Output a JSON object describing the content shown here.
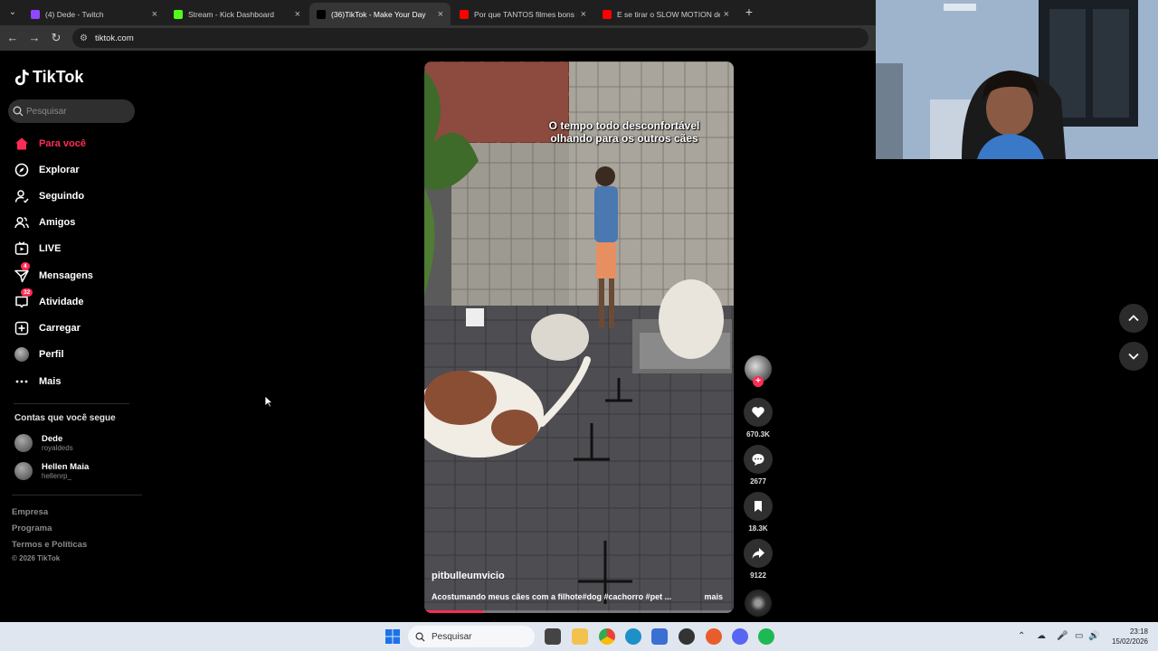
{
  "browser": {
    "tabs": [
      {
        "title": "(4) Dede - Twitch",
        "favicon": "twitch-icon",
        "color": "#9146ff",
        "active": false
      },
      {
        "title": "Stream - Kick Dashboard",
        "favicon": "kick-icon",
        "color": "#53fc18",
        "active": false
      },
      {
        "title": "(36)TikTok - Make Your Day",
        "favicon": "tiktok-icon",
        "color": "#ffffff",
        "active": true
      },
      {
        "title": "Por que TANTOS filmes bons n...",
        "favicon": "youtube-icon",
        "color": "#ff0000",
        "active": false
      },
      {
        "title": "E se tirar o SLOW MOTION de ...",
        "favicon": "youtube-icon",
        "color": "#ff0000",
        "active": false
      }
    ],
    "new_tab": "+",
    "url": "tiktok.com"
  },
  "tiktok": {
    "logo_text": "TikTok",
    "search_placeholder": "Pesquisar",
    "nav": [
      {
        "label": "Para você",
        "icon": "home-icon",
        "active": true
      },
      {
        "label": "Explorar",
        "icon": "compass-icon"
      },
      {
        "label": "Seguindo",
        "icon": "following-icon"
      },
      {
        "label": "Amigos",
        "icon": "friends-icon"
      },
      {
        "label": "LIVE",
        "icon": "live-icon"
      },
      {
        "label": "Mensagens",
        "icon": "messages-icon",
        "badge": "4"
      },
      {
        "label": "Atividade",
        "icon": "activity-icon",
        "badge": "32"
      },
      {
        "label": "Carregar",
        "icon": "upload-icon"
      },
      {
        "label": "Perfil",
        "icon": "profile-avatar"
      },
      {
        "label": "Mais",
        "icon": "more-icon"
      }
    ],
    "following_title": "Contas que você segue",
    "following": [
      {
        "name": "Dede",
        "handle": "royaldeds"
      },
      {
        "name": "Hellen Maia",
        "handle": "hellenrp_"
      }
    ],
    "footer": [
      "Empresa",
      "Programa",
      "Termos e Políticas"
    ],
    "copyright": "© 2026 TikTok",
    "video": {
      "overlay_text_1": "O tempo todo desconfortável",
      "overlay_text_2": "olhando para os outros cães",
      "author": "pitbulleumvicio",
      "description": "Acostumando meus cães com a filhote#dog #cachorro #pet ...",
      "more_label": "mais",
      "progress": 0.19
    },
    "actions": {
      "likes": "670.3K",
      "comments": "2677",
      "saves": "18.3K",
      "shares": "9122"
    },
    "accent": "#fe2c55"
  },
  "taskbar": {
    "search_placeholder": "Pesquisar",
    "time": "23:18",
    "date": "15/02/2026"
  }
}
